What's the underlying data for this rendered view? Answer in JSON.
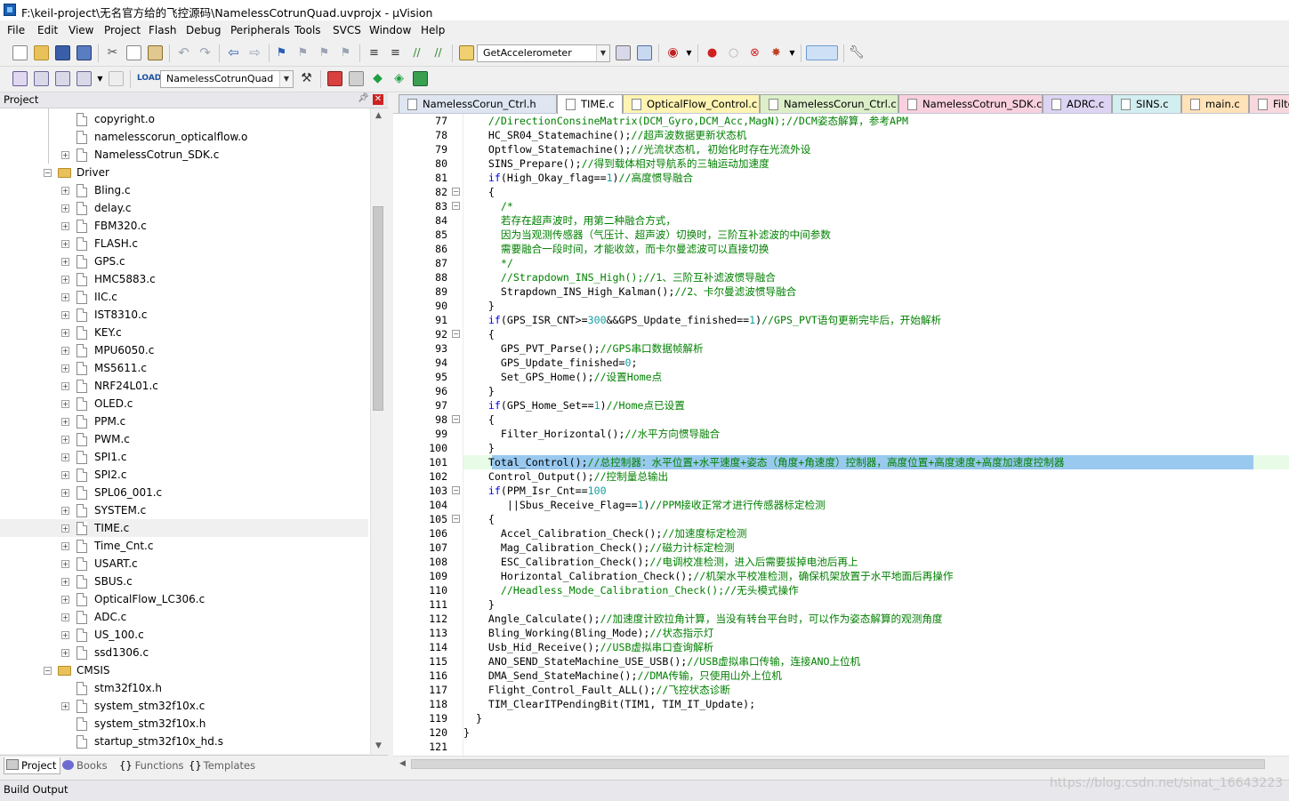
{
  "window": {
    "title": "F:\\keil-project\\无名官方给的飞控源码\\NamelessCotrunQuad.uvprojx - µVision"
  },
  "menu": [
    "File",
    "Edit",
    "View",
    "Project",
    "Flash",
    "Debug",
    "Peripherals",
    "Tools",
    "SVCS",
    "Window",
    "Help"
  ],
  "toolbar": {
    "function_combo": "GetAccelerometer",
    "target_combo": "NamelessCotrunQuad"
  },
  "project_panel": {
    "title": "Project",
    "tree": [
      {
        "label": "copyright.o",
        "level": 2,
        "type": "file",
        "expandable": false
      },
      {
        "label": "namelesscorun_opticalflow.o",
        "level": 2,
        "type": "file",
        "expandable": false
      },
      {
        "label": "NamelessCotrun_SDK.c",
        "level": 2,
        "type": "file",
        "expandable": true
      },
      {
        "label": "Driver",
        "level": 1,
        "type": "folder",
        "expandable": true
      },
      {
        "label": "Bling.c",
        "level": 2,
        "type": "file",
        "expandable": true
      },
      {
        "label": "delay.c",
        "level": 2,
        "type": "file",
        "expandable": true
      },
      {
        "label": "FBM320.c",
        "level": 2,
        "type": "file",
        "expandable": true
      },
      {
        "label": "FLASH.c",
        "level": 2,
        "type": "file",
        "expandable": true
      },
      {
        "label": "GPS.c",
        "level": 2,
        "type": "file",
        "expandable": true
      },
      {
        "label": "HMC5883.c",
        "level": 2,
        "type": "file",
        "expandable": true
      },
      {
        "label": "IIC.c",
        "level": 2,
        "type": "file",
        "expandable": true
      },
      {
        "label": "IST8310.c",
        "level": 2,
        "type": "file",
        "expandable": true
      },
      {
        "label": "KEY.c",
        "level": 2,
        "type": "file",
        "expandable": true
      },
      {
        "label": "MPU6050.c",
        "level": 2,
        "type": "file",
        "expandable": true
      },
      {
        "label": "MS5611.c",
        "level": 2,
        "type": "file",
        "expandable": true
      },
      {
        "label": "NRF24L01.c",
        "level": 2,
        "type": "file",
        "expandable": true
      },
      {
        "label": "OLED.c",
        "level": 2,
        "type": "file",
        "expandable": true
      },
      {
        "label": "PPM.c",
        "level": 2,
        "type": "file",
        "expandable": true
      },
      {
        "label": "PWM.c",
        "level": 2,
        "type": "file",
        "expandable": true
      },
      {
        "label": "SPI1.c",
        "level": 2,
        "type": "file",
        "expandable": true
      },
      {
        "label": "SPI2.c",
        "level": 2,
        "type": "file",
        "expandable": true
      },
      {
        "label": "SPL06_001.c",
        "level": 2,
        "type": "file",
        "expandable": true
      },
      {
        "label": "SYSTEM.c",
        "level": 2,
        "type": "file",
        "expandable": true
      },
      {
        "label": "TIME.c",
        "level": 2,
        "type": "file",
        "expandable": true,
        "selected": true
      },
      {
        "label": "Time_Cnt.c",
        "level": 2,
        "type": "file",
        "expandable": true
      },
      {
        "label": "USART.c",
        "level": 2,
        "type": "file",
        "expandable": true
      },
      {
        "label": "SBUS.c",
        "level": 2,
        "type": "file",
        "expandable": true
      },
      {
        "label": "OpticalFlow_LC306.c",
        "level": 2,
        "type": "file",
        "expandable": true
      },
      {
        "label": "ADC.c",
        "level": 2,
        "type": "file",
        "expandable": true
      },
      {
        "label": "US_100.c",
        "level": 2,
        "type": "file",
        "expandable": true
      },
      {
        "label": "ssd1306.c",
        "level": 2,
        "type": "file",
        "expandable": true
      },
      {
        "label": "CMSIS",
        "level": 1,
        "type": "folder",
        "expandable": true
      },
      {
        "label": "stm32f10x.h",
        "level": 2,
        "type": "file",
        "expandable": false
      },
      {
        "label": "system_stm32f10x.c",
        "level": 2,
        "type": "file",
        "expandable": true
      },
      {
        "label": "system_stm32f10x.h",
        "level": 2,
        "type": "file",
        "expandable": false
      },
      {
        "label": "startup_stm32f10x_hd.s",
        "level": 2,
        "type": "file",
        "expandable": false
      }
    ],
    "tabs": [
      "Project",
      "Books",
      "Functions",
      "Templates"
    ]
  },
  "editor": {
    "tabs": [
      {
        "label": "NamelessCorun_Ctrl.h",
        "color": "#dfe6f2",
        "active": false
      },
      {
        "label": "TIME.c",
        "color": "#ffffff",
        "active": true
      },
      {
        "label": "OpticalFlow_Control.c",
        "color": "#fff4b3",
        "active": false
      },
      {
        "label": "NamelessCorun_Ctrl.c",
        "color": "#dcefc9",
        "active": false
      },
      {
        "label": "NamelessCotrun_SDK.c",
        "color": "#f9d0de",
        "active": false
      },
      {
        "label": "ADRC.c",
        "color": "#dcd4f2",
        "active": false
      },
      {
        "label": "SINS.c",
        "color": "#d2eef0",
        "active": false
      },
      {
        "label": "main.c",
        "color": "#ffe2b8",
        "active": false
      },
      {
        "label": "Filter",
        "color": "#f8d8dc",
        "active": false
      }
    ],
    "lines": [
      {
        "n": "77",
        "fold": "",
        "tokens": [
          [
            "    ",
            ""
          ],
          [
            "//DirectionConsineMatrix(DCM_Gyro,DCM_Acc,MagN);//DCM姿态解算，参考APM",
            "c"
          ]
        ]
      },
      {
        "n": "78",
        "fold": "",
        "tokens": [
          [
            "    HC_SR04_Statemachine();",
            ""
          ],
          [
            "//超声波数据更新状态机",
            "c"
          ]
        ]
      },
      {
        "n": "79",
        "fold": "",
        "tokens": [
          [
            "    Optflow_Statemachine();",
            ""
          ],
          [
            "//光流状态机, 初始化时存在光流外设",
            "c"
          ]
        ]
      },
      {
        "n": "80",
        "fold": "",
        "tokens": [
          [
            "    SINS_Prepare();",
            ""
          ],
          [
            "//得到载体相对导航系的三轴运动加速度",
            "c"
          ]
        ]
      },
      {
        "n": "81",
        "fold": "",
        "tokens": [
          [
            "    ",
            ""
          ],
          [
            "if",
            "k"
          ],
          [
            "(High_Okay_flag==",
            ""
          ],
          [
            "1",
            "n"
          ],
          [
            ")",
            ""
          ],
          [
            "//高度惯导融合",
            "c"
          ]
        ]
      },
      {
        "n": "82",
        "fold": "-",
        "tokens": [
          [
            "    {",
            ""
          ]
        ]
      },
      {
        "n": "83",
        "fold": "-",
        "tokens": [
          [
            "      ",
            ""
          ],
          [
            "/*",
            "c"
          ]
        ]
      },
      {
        "n": "84",
        "fold": "",
        "tokens": [
          [
            "      ",
            ""
          ],
          [
            "若存在超声波时，用第二种融合方式，",
            "c"
          ]
        ]
      },
      {
        "n": "85",
        "fold": "",
        "tokens": [
          [
            "      ",
            ""
          ],
          [
            "因为当观测传感器（气压计、超声波）切换时，三阶互补滤波的中间参数",
            "c"
          ]
        ]
      },
      {
        "n": "86",
        "fold": "",
        "tokens": [
          [
            "      ",
            ""
          ],
          [
            "需要融合一段时间，才能收敛，而卡尔曼滤波可以直接切换",
            "c"
          ]
        ]
      },
      {
        "n": "87",
        "fold": "",
        "tokens": [
          [
            "      ",
            ""
          ],
          [
            "*/",
            "c"
          ]
        ]
      },
      {
        "n": "88",
        "fold": "",
        "tokens": [
          [
            "      ",
            ""
          ],
          [
            "//Strapdown_INS_High();//1、三阶互补滤波惯导融合",
            "c"
          ]
        ]
      },
      {
        "n": "89",
        "fold": "",
        "tokens": [
          [
            "      Strapdown_INS_High_Kalman();",
            ""
          ],
          [
            "//2、卡尔曼滤波惯导融合",
            "c"
          ]
        ]
      },
      {
        "n": "90",
        "fold": "",
        "tokens": [
          [
            "    }",
            ""
          ]
        ]
      },
      {
        "n": "91",
        "fold": "",
        "tokens": [
          [
            "    ",
            ""
          ],
          [
            "if",
            "k"
          ],
          [
            "(GPS_ISR_CNT>=",
            ""
          ],
          [
            "300",
            "n"
          ],
          [
            "&&GPS_Update_finished==",
            ""
          ],
          [
            "1",
            "n"
          ],
          [
            ")",
            ""
          ],
          [
            "//GPS_PVT语句更新完毕后，开始解析",
            "c"
          ]
        ]
      },
      {
        "n": "92",
        "fold": "-",
        "tokens": [
          [
            "    {",
            ""
          ]
        ]
      },
      {
        "n": "93",
        "fold": "",
        "tokens": [
          [
            "      GPS_PVT_Parse();",
            ""
          ],
          [
            "//GPS串口数据帧解析",
            "c"
          ]
        ]
      },
      {
        "n": "94",
        "fold": "",
        "tokens": [
          [
            "      GPS_Update_finished=",
            ""
          ],
          [
            "0",
            "n"
          ],
          [
            ";",
            ""
          ]
        ]
      },
      {
        "n": "95",
        "fold": "",
        "tokens": [
          [
            "      Set_GPS_Home();",
            ""
          ],
          [
            "//设置Home点",
            "c"
          ]
        ]
      },
      {
        "n": "96",
        "fold": "",
        "tokens": [
          [
            "    }",
            ""
          ]
        ]
      },
      {
        "n": "97",
        "fold": "",
        "tokens": [
          [
            "    ",
            ""
          ],
          [
            "if",
            "k"
          ],
          [
            "(GPS_Home_Set==",
            ""
          ],
          [
            "1",
            "n"
          ],
          [
            ")",
            ""
          ],
          [
            "//Home点已设置",
            "c"
          ]
        ]
      },
      {
        "n": "98",
        "fold": "-",
        "tokens": [
          [
            "    {",
            ""
          ]
        ]
      },
      {
        "n": "99",
        "fold": "",
        "tokens": [
          [
            "      Filter_Horizontal();",
            ""
          ],
          [
            "//水平方向惯导融合",
            "c"
          ]
        ]
      },
      {
        "n": "100",
        "fold": "",
        "tokens": [
          [
            "    }",
            ""
          ]
        ]
      },
      {
        "n": "101",
        "fold": "",
        "highlight": true,
        "tokens": [
          [
            "    Total_Control();",
            ""
          ],
          [
            "//总控制器：水平位置+水平速度+姿态（角度+角速度）控制器，高度位置+高度速度+高度加速度控制器",
            "c"
          ]
        ]
      },
      {
        "n": "102",
        "fold": "",
        "tokens": [
          [
            "    Control_Output();",
            ""
          ],
          [
            "//控制量总输出",
            "c"
          ]
        ]
      },
      {
        "n": "103",
        "fold": "-",
        "tokens": [
          [
            "    ",
            ""
          ],
          [
            "if",
            "k"
          ],
          [
            "(PPM_Isr_Cnt==",
            ""
          ],
          [
            "100",
            "n"
          ]
        ]
      },
      {
        "n": "104",
        "fold": "",
        "tokens": [
          [
            "       ||Sbus_Receive_Flag==",
            ""
          ],
          [
            "1",
            "n"
          ],
          [
            ")",
            ""
          ],
          [
            "//PPM接收正常才进行传感器标定检测",
            "c"
          ]
        ]
      },
      {
        "n": "105",
        "fold": "-",
        "tokens": [
          [
            "    {",
            ""
          ]
        ]
      },
      {
        "n": "106",
        "fold": "",
        "tokens": [
          [
            "      Accel_Calibration_Check();",
            ""
          ],
          [
            "//加速度标定检测",
            "c"
          ]
        ]
      },
      {
        "n": "107",
        "fold": "",
        "tokens": [
          [
            "      Mag_Calibration_Check();",
            ""
          ],
          [
            "//磁力计标定检测",
            "c"
          ]
        ]
      },
      {
        "n": "108",
        "fold": "",
        "tokens": [
          [
            "      ESC_Calibration_Check();",
            ""
          ],
          [
            "//电调校准检测，进入后需要拔掉电池后再上",
            "c"
          ]
        ]
      },
      {
        "n": "109",
        "fold": "",
        "tokens": [
          [
            "      Horizontal_Calibration_Check();",
            ""
          ],
          [
            "//机架水平校准检测，确保机架放置于水平地面后再操作",
            "c"
          ]
        ]
      },
      {
        "n": "110",
        "fold": "",
        "tokens": [
          [
            "      ",
            ""
          ],
          [
            "//Headless_Mode_Calibration_Check();//无头模式操作",
            "c"
          ]
        ]
      },
      {
        "n": "111",
        "fold": "",
        "tokens": [
          [
            "    }",
            ""
          ]
        ]
      },
      {
        "n": "112",
        "fold": "",
        "tokens": [
          [
            "    Angle_Calculate();",
            ""
          ],
          [
            "//加速度计欧拉角计算，当没有转台平台时，可以作为姿态解算的观测角度",
            "c"
          ]
        ]
      },
      {
        "n": "113",
        "fold": "",
        "tokens": [
          [
            "    Bling_Working(Bling_Mode);",
            ""
          ],
          [
            "//状态指示灯",
            "c"
          ]
        ]
      },
      {
        "n": "114",
        "fold": "",
        "tokens": [
          [
            "    Usb_Hid_Receive();",
            ""
          ],
          [
            "//USB虚拟串口查询解析",
            "c"
          ]
        ]
      },
      {
        "n": "115",
        "fold": "",
        "tokens": [
          [
            "    ANO_SEND_StateMachine_USE_USB();",
            ""
          ],
          [
            "//USB虚拟串口传输，连接ANO上位机",
            "c"
          ]
        ]
      },
      {
        "n": "116",
        "fold": "",
        "tokens": [
          [
            "    DMA_Send_StateMachine();",
            ""
          ],
          [
            "//DMA传输，只使用山外上位机",
            "c"
          ]
        ]
      },
      {
        "n": "117",
        "fold": "",
        "tokens": [
          [
            "    Flight_Control_Fault_ALL();",
            ""
          ],
          [
            "//飞控状态诊断",
            "c"
          ]
        ]
      },
      {
        "n": "118",
        "fold": "",
        "tokens": [
          [
            "    TIM_ClearITPendingBit(TIM1, TIM_IT_Update);",
            ""
          ]
        ]
      },
      {
        "n": "119",
        "fold": "",
        "tokens": [
          [
            "  }",
            ""
          ]
        ]
      },
      {
        "n": "120",
        "fold": "",
        "tokens": [
          [
            "}",
            ""
          ]
        ]
      },
      {
        "n": "121",
        "fold": "",
        "tokens": [
          [
            "",
            ""
          ]
        ]
      }
    ]
  },
  "build_output": {
    "title": "Build Output"
  },
  "watermark": "https://blog.csdn.net/sinat_16643223"
}
